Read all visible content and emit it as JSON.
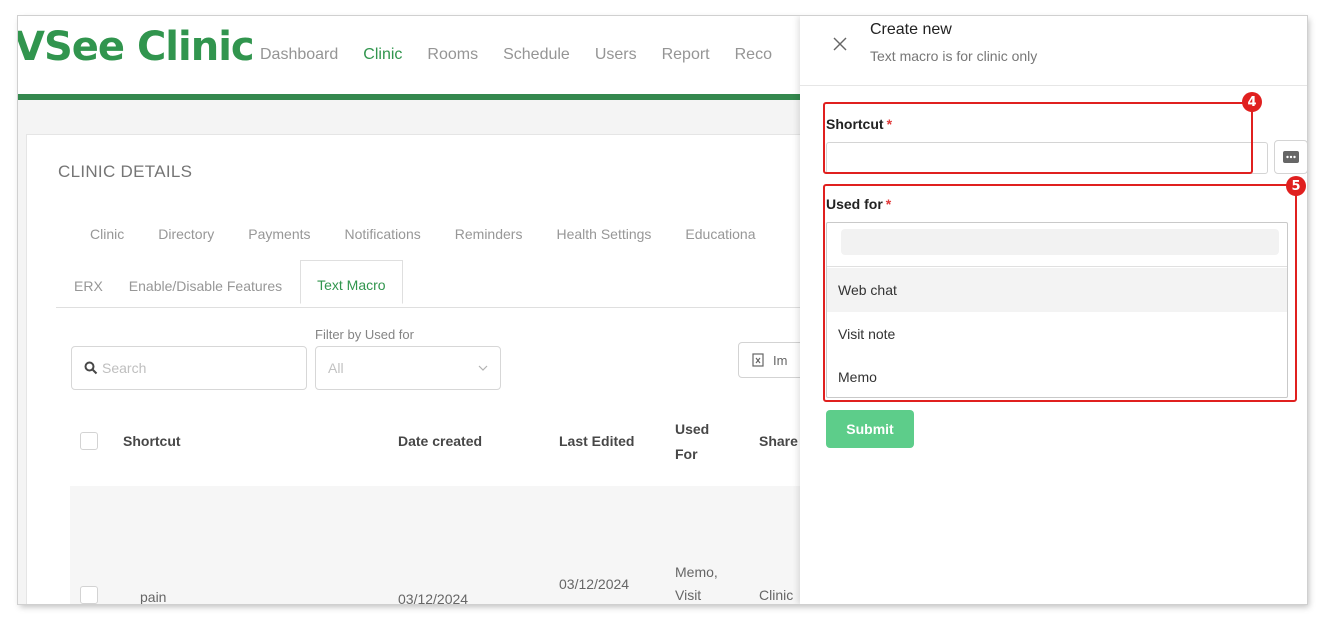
{
  "app": {
    "logo": "VSee Clinic",
    "nav": [
      "Dashboard",
      "Clinic",
      "Rooms",
      "Schedule",
      "Users",
      "Report",
      "Reco"
    ],
    "active_nav": "Clinic",
    "brand_color": "#1a8a3a"
  },
  "clinic": {
    "title": "CLINIC DETAILS",
    "tabs_row1": [
      "Clinic",
      "Directory",
      "Payments",
      "Notifications",
      "Reminders",
      "Health Settings",
      "Educationa"
    ],
    "tabs_row2": [
      "ERX",
      "Enable/Disable Features",
      "Text Macro"
    ],
    "active_tab": "Text Macro",
    "filter_label": "Filter by Used for",
    "search_placeholder": "Search",
    "filter_value": "All",
    "import_label": "Im",
    "table": {
      "headers": [
        "Shortcut",
        "Date created",
        "Last Edited",
        "Used For",
        "Share"
      ],
      "header_used_line1": "Used",
      "header_used_line2": "For",
      "rows": [
        {
          "shortcut": "pain",
          "date_created": "03/12/2024",
          "last_edited": "03/12/2024",
          "used_for_line1": "Memo,",
          "used_for_line2": "Visit",
          "share": "Clinic"
        }
      ]
    }
  },
  "drawer": {
    "title": "Create new",
    "subtitle": "Text macro is for clinic only",
    "shortcut_label": "Shortcut",
    "required_mark": "*",
    "shortcut_value": "",
    "used_for_label": "Used for",
    "options": [
      "Web chat",
      "Visit note",
      "Memo"
    ],
    "highlighted_option": "Web chat",
    "submit_label": "Submit",
    "submit_color": "#5dcd8a"
  },
  "annotations": {
    "badges": [
      "4",
      "5"
    ],
    "color": "#e0201f"
  }
}
